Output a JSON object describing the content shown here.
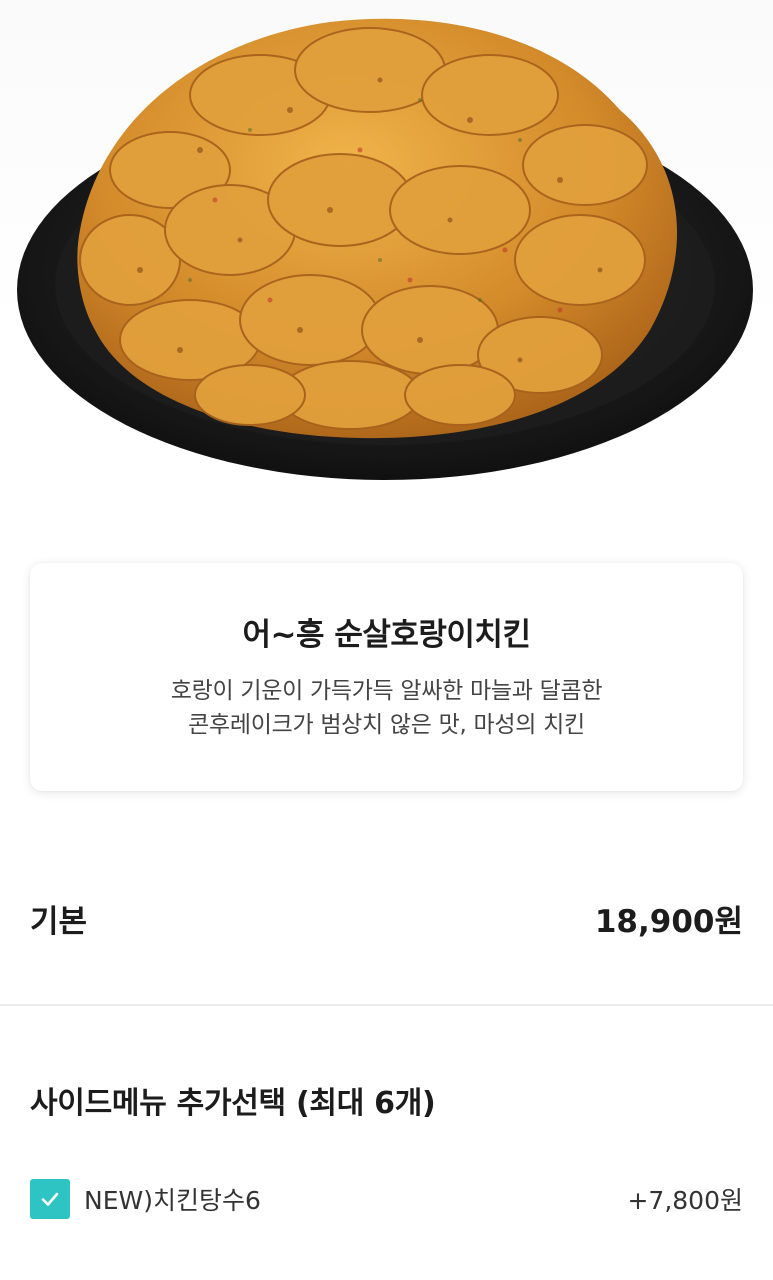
{
  "product": {
    "image_icon": "fried-chicken-plate-image",
    "title": "어~흥 순살호랑이치킨",
    "description_line1": "호랑이 기운이 가득가득 알싸한 마늘과 달콤한",
    "description_line2": "콘후레이크가 범상치 않은 맛, 마성의 치킨"
  },
  "base": {
    "label": "기본",
    "price": "18,900원"
  },
  "side_menu": {
    "title": "사이드메뉴 추가선택 (최대 6개)",
    "options": [
      {
        "label": "NEW)치킨탕수6",
        "price": "+7,800원",
        "checked": true,
        "icon": "check-icon"
      }
    ]
  },
  "colors": {
    "accent": "#2ec4c4",
    "plate": "#1b1b1b",
    "chicken": "#d8962f"
  }
}
